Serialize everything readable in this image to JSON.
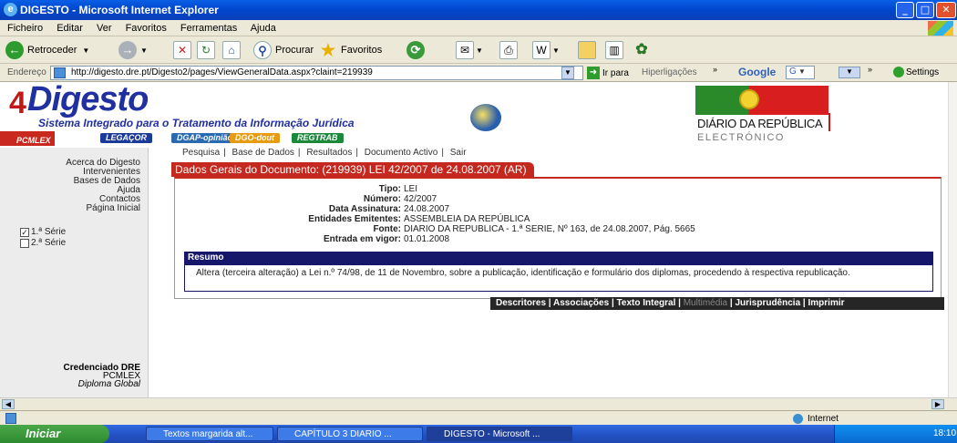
{
  "window": {
    "title": "DIGESTO - Microsoft Internet Explorer"
  },
  "menu": [
    "Ficheiro",
    "Editar",
    "Ver",
    "Favoritos",
    "Ferramentas",
    "Ajuda"
  ],
  "toolbar": {
    "back": "Retroceder",
    "search": "Procurar",
    "favorites": "Favoritos"
  },
  "address": {
    "label": "Endereço",
    "url": "http://digesto.dre.pt/Digesto2/pages/ViewGeneralData.aspx?claint=219939",
    "go": "Ir para",
    "links": "Hiperligações",
    "google": "Google",
    "google_g": "G",
    "settings": "Settings"
  },
  "banner": {
    "mark": "4",
    "logo": "Digesto",
    "subtitle": "Sistema Integrado para o Tratamento da Informação Jurídica",
    "pills": [
      "LEGAÇOR",
      "DGAP-opinião",
      "DGO-dout",
      "REGTRAB"
    ],
    "pcmlex": "PCMLEX",
    "dre_line1": "DIÁRIO DA REPÚBLICA",
    "dre_line2": "ELECTRÓNICO"
  },
  "nav": [
    "Pesquisa",
    "Base de Dados",
    "Resultados",
    "Documento Activo",
    "Sair"
  ],
  "sidebar": {
    "links": [
      "Acerca do Digesto",
      "Intervenientes",
      "Bases de Dados",
      "Ajuda",
      "Contactos",
      "Página Inicial"
    ],
    "series": [
      {
        "label": "1.ª Série",
        "checked": true
      },
      {
        "label": "2.ª Série",
        "checked": false
      }
    ],
    "cred_title": "Credenciado DRE",
    "cred_line1": "PCMLEX",
    "cred_line2": "Diploma Global"
  },
  "doc": {
    "header": "Dados Gerais do Documento: (219939) LEI 42/2007 de 24.08.2007 (AR)",
    "fields": [
      {
        "label": "Tipo:",
        "value": "LEI"
      },
      {
        "label": "Número:",
        "value": "42/2007"
      },
      {
        "label": "Data Assinatura:",
        "value": "24.08.2007"
      },
      {
        "label": "Entidades Emitentes:",
        "value": "ASSEMBLEIA DA REPÚBLICA"
      },
      {
        "label": "Fonte:",
        "value": "DIARIO DA REPUBLICA - 1.ª SERIE, Nº 163, de 24.08.2007, Pág. 5665"
      },
      {
        "label": "Entrada em vigor:",
        "value": "01.01.2008"
      }
    ],
    "resumo_title": "Resumo",
    "resumo_text": "Altera (terceira alteração) a Lei n.º 74/98, de 11 de Novembro, sobre a publicação, identificação e formulário dos diplomas, procedendo à respectiva republicação."
  },
  "bottom_links": [
    "Descritores",
    "Associações",
    "Texto Integral",
    "Multimédia",
    "Jurisprudência",
    "Imprimir"
  ],
  "status": {
    "zone": "Internet"
  },
  "taskbar": {
    "start": "Iniciar",
    "tasks": [
      "Textos margarida alt...",
      "CAPÍTULO 3 DIARIO ...",
      "DIGESTO - Microsoft ..."
    ],
    "clock": "18:10"
  }
}
